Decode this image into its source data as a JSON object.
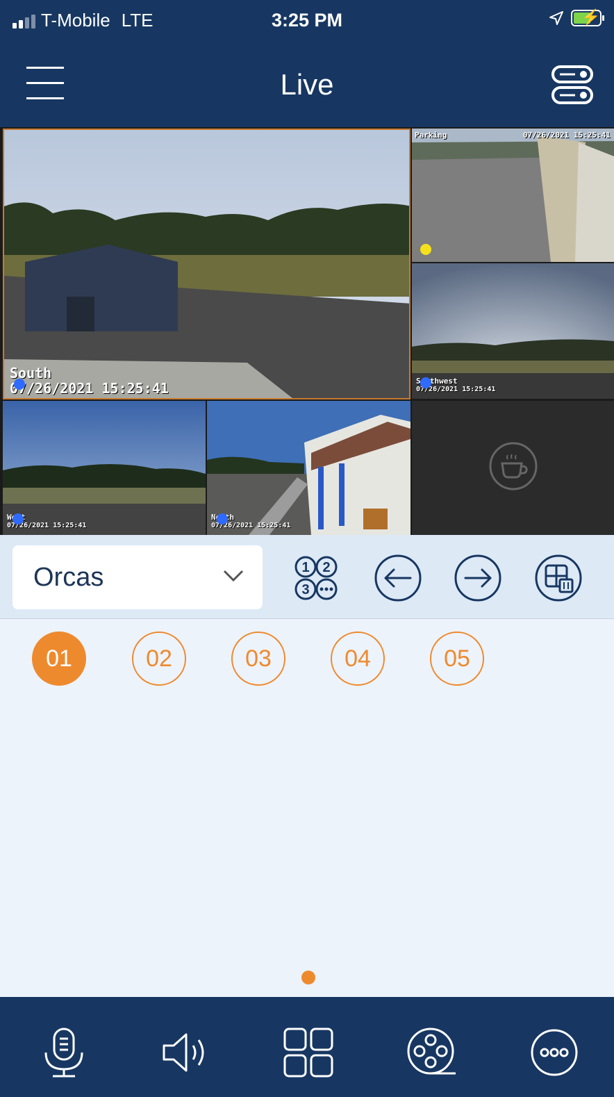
{
  "status": {
    "carrier": "T-Mobile",
    "network": "LTE",
    "time": "3:25 PM"
  },
  "header": {
    "title": "Live"
  },
  "cameras": [
    {
      "name": "South",
      "timestamp": "07/26/2021 15:25:41",
      "status_color": "#2f6bff"
    },
    {
      "name": "Parking",
      "timestamp": "07/26/2021 15:25:41",
      "status_color": "#f5e11b"
    },
    {
      "name": "Southwest",
      "timestamp": "07/26/2021 15:25:41",
      "status_color": "#2f6bff"
    },
    {
      "name": "West",
      "timestamp": "07/26/2021 15:25:41",
      "status_color": "#2f6bff"
    },
    {
      "name": "North",
      "timestamp": "07/26/2021 15:25:41",
      "status_color": "#2f6bff"
    }
  ],
  "toolbar": {
    "site": "Orcas"
  },
  "presets": [
    "01",
    "02",
    "03",
    "04",
    "05"
  ],
  "icons": [
    "menu-icon",
    "server-settings-icon",
    "coffee-cup-icon",
    "chevron-down-icon",
    "numbered-channels-icon",
    "previous-arrow-icon",
    "next-arrow-icon",
    "layout-delete-icon",
    "microphone-icon",
    "speaker-icon",
    "grid-layout-icon",
    "film-reel-icon",
    "more-icon"
  ],
  "colors": {
    "brand": "#173762",
    "accent": "#ee8a2e",
    "camera_online": "#2f6bff",
    "camera_alert": "#f5e11b"
  }
}
